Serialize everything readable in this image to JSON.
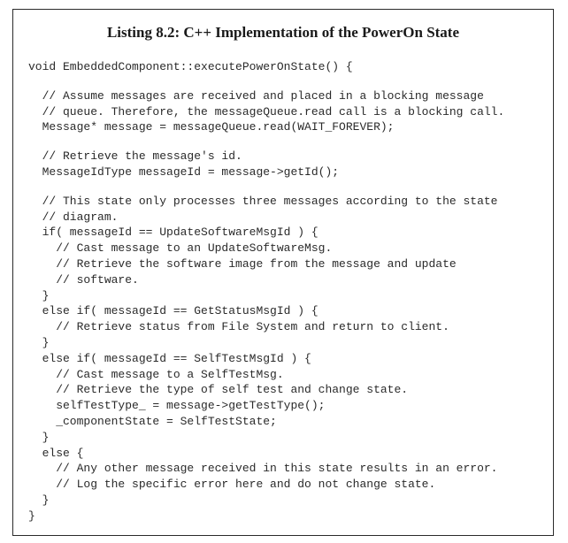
{
  "listing": {
    "title": "Listing 8.2: C++ Implementation of the PowerOn State",
    "lines": [
      "void EmbeddedComponent::executePowerOnState() {",
      "",
      "  // Assume messages are received and placed in a blocking message",
      "  // queue. Therefore, the messageQueue.read call is a blocking call.",
      "  Message* message = messageQueue.read(WAIT_FOREVER);",
      "",
      "  // Retrieve the message's id.",
      "  MessageIdType messageId = message->getId();",
      "",
      "  // This state only processes three messages according to the state",
      "  // diagram.",
      "  if( messageId == UpdateSoftwareMsgId ) {",
      "    // Cast message to an UpdateSoftwareMsg.",
      "    // Retrieve the software image from the message and update",
      "    // software.",
      "  }",
      "  else if( messageId == GetStatusMsgId ) {",
      "    // Retrieve status from File System and return to client.",
      "  }",
      "  else if( messageId == SelfTestMsgId ) {",
      "    // Cast message to a SelfTestMsg.",
      "    // Retrieve the type of self test and change state.",
      "    selfTestType_ = message->getTestType();",
      "    _componentState = SelfTestState;",
      "  }",
      "  else {",
      "    // Any other message received in this state results in an error.",
      "    // Log the specific error here and do not change state.",
      "  }",
      "}"
    ]
  }
}
